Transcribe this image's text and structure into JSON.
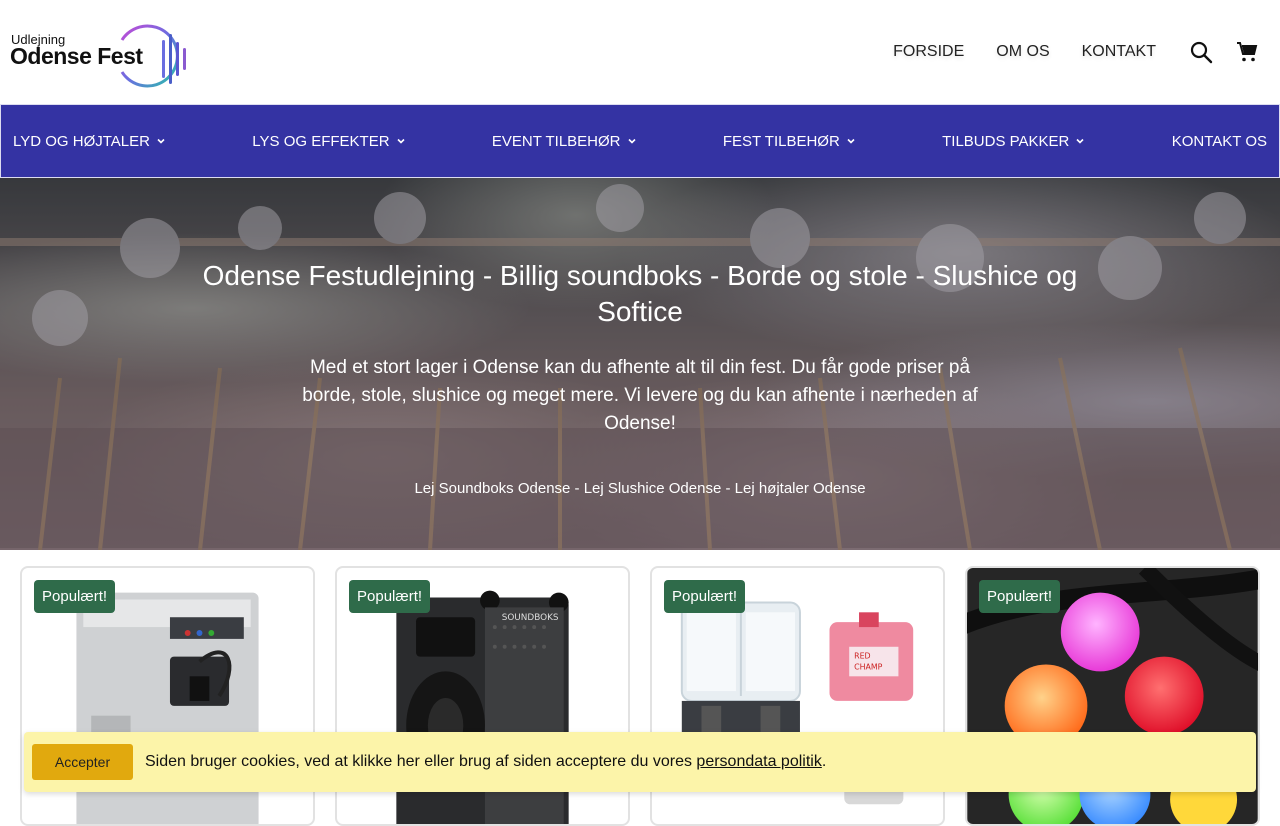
{
  "logo": {
    "small": "Udlejning",
    "big": "Odense Fest"
  },
  "topnav": {
    "items": [
      "FORSIDE",
      "OM OS",
      "KONTAKT"
    ],
    "search_icon": "search-icon",
    "cart_icon": "cart-icon"
  },
  "mainnav": {
    "items": [
      "LYD OG HØJTALER",
      "LYS OG EFFEKTER",
      "EVENT TILBEHØR",
      "FEST TILBEHØR",
      "TILBUDS PAKKER",
      "KONTAKT OS"
    ]
  },
  "hero": {
    "title": "Odense Festudlejning - Billig soundboks - Borde og stole - Slushice og Softice",
    "subtitle": "Med et stort lager i Odense kan du afhente alt til din fest. Du får gode priser på borde, stole, slushice og meget mere. Vi levere og du kan afhente i nærheden af Odense!",
    "links": "Lej Soundboks Odense - Lej Slushice Odense - Lej højtaler Odense"
  },
  "products": [
    {
      "badge": "Populært!",
      "image": "softice-machine"
    },
    {
      "badge": "Populært!",
      "image": "soundboks-speaker"
    },
    {
      "badge": "Populært!",
      "image": "slushice-machine"
    },
    {
      "badge": "Populært!",
      "image": "led-balls"
    }
  ],
  "cookie": {
    "button": "Accepter",
    "text": "Siden bruger cookies, ved at klikke her eller brug af siden acceptere du vores ",
    "link": "persondata politik",
    "end": "."
  },
  "colors": {
    "nav_bg": "#3433a3",
    "badge": "#2f6b4a",
    "cookie_bg": "#fcf4a9",
    "accept": "#e1a90e"
  }
}
